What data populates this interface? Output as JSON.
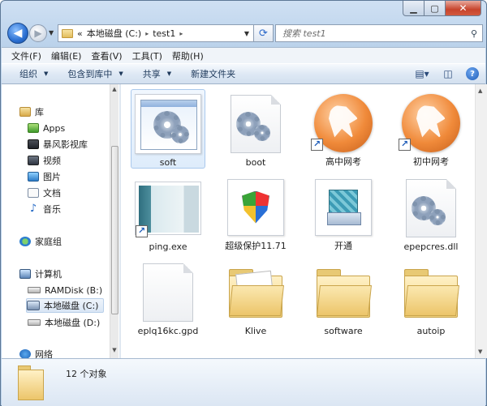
{
  "titlebar": {
    "minimize_glyph": "▁",
    "maximize_glyph": "▢",
    "close_glyph": "✕"
  },
  "address": {
    "root_marker": "«",
    "crumbs": [
      "本地磁盘 (C:)",
      "test1"
    ],
    "separator": "▸",
    "dropdown_glyph": "▼"
  },
  "search": {
    "placeholder": "搜索 test1"
  },
  "menu": [
    "文件(F)",
    "编辑(E)",
    "查看(V)",
    "工具(T)",
    "帮助(H)"
  ],
  "toolbar": {
    "buttons": [
      "组织",
      "包含到库中",
      "共享",
      "新建文件夹"
    ],
    "dropdown_glyph": "▼"
  },
  "nav": {
    "library": "库",
    "library_items": [
      "Apps",
      "暴风影视库",
      "视频",
      "图片",
      "文档",
      "音乐"
    ],
    "homegroup": "家庭组",
    "computer": "计算机",
    "drives": [
      "RAMDisk (B:)",
      "本地磁盘 (C:)",
      "本地磁盘 (D:)"
    ],
    "network": "网络"
  },
  "items": [
    {
      "name": "soft",
      "icon": "settings-window-icon",
      "shortcut": false
    },
    {
      "name": "boot",
      "icon": "settings-file-icon",
      "shortcut": false
    },
    {
      "name": "高中网考",
      "icon": "cheetah-browser-icon",
      "shortcut": true
    },
    {
      "name": "初中网考",
      "icon": "cheetah-browser-icon",
      "shortcut": true
    },
    {
      "name": "ping.exe",
      "icon": "window-thumbnail-icon",
      "shortcut": true
    },
    {
      "name": "超级保护11.71",
      "icon": "shield-icon",
      "shortcut": false
    },
    {
      "name": "开通",
      "icon": "installer-icon",
      "shortcut": false
    },
    {
      "name": "epepcres.dll",
      "icon": "settings-file-icon",
      "shortcut": false
    },
    {
      "name": "eplq16kc.gpd",
      "icon": "blank-file-icon",
      "shortcut": false
    },
    {
      "name": "Klive",
      "icon": "folder-icon",
      "shortcut": false
    },
    {
      "name": "software",
      "icon": "folder-icon",
      "shortcut": false
    },
    {
      "name": "autoip",
      "icon": "folder-icon",
      "shortcut": false
    }
  ],
  "status": {
    "count_text": "12 个对象"
  },
  "colors": {
    "accent": "#2a6fd2",
    "selection": "#deecfb",
    "close_red": "#c7442c"
  }
}
